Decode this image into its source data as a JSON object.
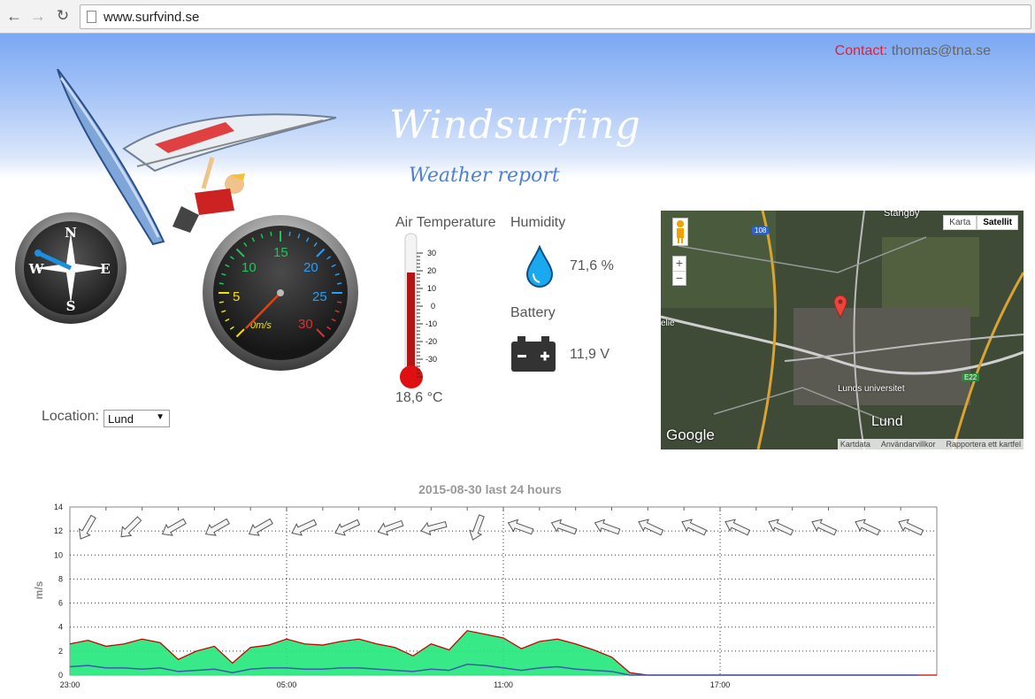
{
  "browser": {
    "back_icon": "back-arrow-icon",
    "forward_icon": "forward-arrow-icon",
    "reload_icon": "reload-icon",
    "url": "www.surfvind.se"
  },
  "header": {
    "contact_label": "Contact:",
    "contact_email": "thomas@tna.se",
    "title": "Windsurfing",
    "subtitle": "Weather report"
  },
  "compass": {
    "N": "N",
    "E": "E",
    "S": "S",
    "W": "W"
  },
  "speedometer": {
    "labels": [
      "0m/s",
      "5",
      "10",
      "15",
      "20",
      "25",
      "30"
    ],
    "value": 0
  },
  "temperature": {
    "label": "Air Temperature",
    "value": "18,6 °C",
    "scale": [
      "30",
      "20",
      "10",
      "0",
      "-10",
      "-20",
      "-30"
    ]
  },
  "humidity": {
    "label": "Humidity",
    "value": "71,6 %"
  },
  "battery": {
    "label": "Battery",
    "value": "11,9 V"
  },
  "location": {
    "label": "Location:",
    "selected": "Lund"
  },
  "map": {
    "btn_map": "Karta",
    "btn_satellite": "Satellit",
    "zoom_in": "+",
    "zoom_out": "−",
    "label_stangby": "Stångby",
    "label_lund": "Lund",
    "label_univ": "Lunds universitet",
    "label_elie": "elie",
    "route_108": "108",
    "route_e22": "E22",
    "google": "Google",
    "footer_mapdata": "Kartdata",
    "footer_terms": "Användarvillkor",
    "footer_report": "Rapportera ett kartfel"
  },
  "chart_data": {
    "type": "area",
    "title": "2015-08-30 last 24 hours",
    "ylabel": "m/s",
    "ylim": [
      0,
      14
    ],
    "yticks": [
      "0",
      "2",
      "4",
      "6",
      "8",
      "10",
      "12",
      "14"
    ],
    "xticks": [
      "23:00",
      "05:00",
      "11:00",
      "17:00"
    ],
    "x": [
      0,
      0.5,
      1,
      1.5,
      2,
      2.5,
      3,
      3.5,
      4,
      4.5,
      5,
      5.5,
      6,
      6.5,
      7,
      7.5,
      8,
      8.5,
      9,
      9.5,
      10,
      10.5,
      11,
      11.5,
      12,
      12.5,
      13,
      13.5,
      14,
      14.5,
      15,
      15.5,
      16,
      16.5,
      17,
      17.5,
      18,
      18.5,
      19,
      19.5,
      20,
      20.5,
      21,
      21.5,
      22,
      22.5,
      23,
      23.5
    ],
    "series": [
      {
        "color": "#cc0000",
        "fill": "#22e87a",
        "values": [
          2.6,
          2.9,
          2.4,
          2.6,
          3.0,
          2.7,
          1.3,
          2.0,
          2.4,
          1.0,
          2.3,
          2.5,
          3.0,
          2.6,
          2.5,
          2.8,
          3.0,
          2.6,
          2.3,
          1.6,
          2.6,
          2.1,
          3.7,
          3.4,
          3.1,
          2.2,
          2.8,
          3.0,
          2.6,
          2.1,
          1.5,
          0.2,
          0,
          0,
          0,
          0,
          0,
          0,
          0,
          0,
          0,
          0,
          0,
          0,
          0,
          0,
          0,
          0
        ]
      },
      {
        "color": "#3a5ca8",
        "values": [
          0.7,
          0.8,
          0.6,
          0.6,
          0.5,
          0.6,
          0.3,
          0.4,
          0.5,
          0.2,
          0.5,
          0.6,
          0.6,
          0.5,
          0.5,
          0.6,
          0.6,
          0.5,
          0.4,
          0.3,
          0.5,
          0.4,
          0.9,
          0.8,
          0.6,
          0.4,
          0.6,
          0.7,
          0.5,
          0.4,
          0.3,
          0.0,
          0,
          0,
          0,
          0,
          0,
          0,
          0,
          0,
          0,
          0,
          0,
          0,
          0,
          0,
          0,
          0
        ]
      }
    ],
    "direction_arrows": [
      120,
      135,
      150,
      150,
      150,
      155,
      155,
      160,
      165,
      110,
      200,
      200,
      200,
      205,
      205,
      205,
      205,
      205,
      205,
      205
    ],
    "grid": true
  }
}
